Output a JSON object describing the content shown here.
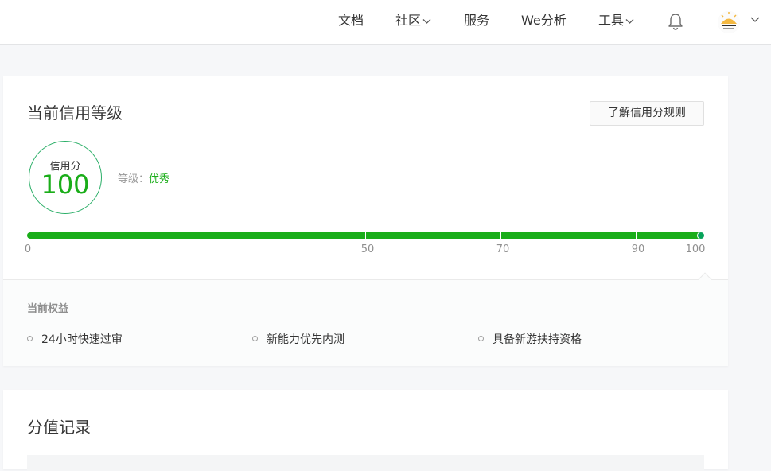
{
  "nav": {
    "items": [
      {
        "label": "文档",
        "has_dropdown": false
      },
      {
        "label": "社区",
        "has_dropdown": true
      },
      {
        "label": "服务",
        "has_dropdown": false
      },
      {
        "label": "We分析",
        "has_dropdown": false
      },
      {
        "label": "工具",
        "has_dropdown": true
      }
    ],
    "icons": [
      "bell-icon",
      "avatar",
      "chevron-down-icon"
    ]
  },
  "credit": {
    "title": "当前信用等级",
    "rules_button": "了解信用分规则",
    "score_label": "信用分",
    "score": "100",
    "level_label": "等级：",
    "level_value": "优秀",
    "progress_fraction": 1.0,
    "ticks": [
      "0",
      "50",
      "70",
      "90",
      "100"
    ]
  },
  "benefits": {
    "title": "当前权益",
    "items": [
      "24小时快速过审",
      "新能力优先内测",
      "具备新游扶持资格"
    ]
  },
  "records": {
    "title": "分值记录"
  },
  "colors": {
    "accent": "#1aad19",
    "circle_border": "#2aae67",
    "muted_text": "#8f8f8f"
  }
}
